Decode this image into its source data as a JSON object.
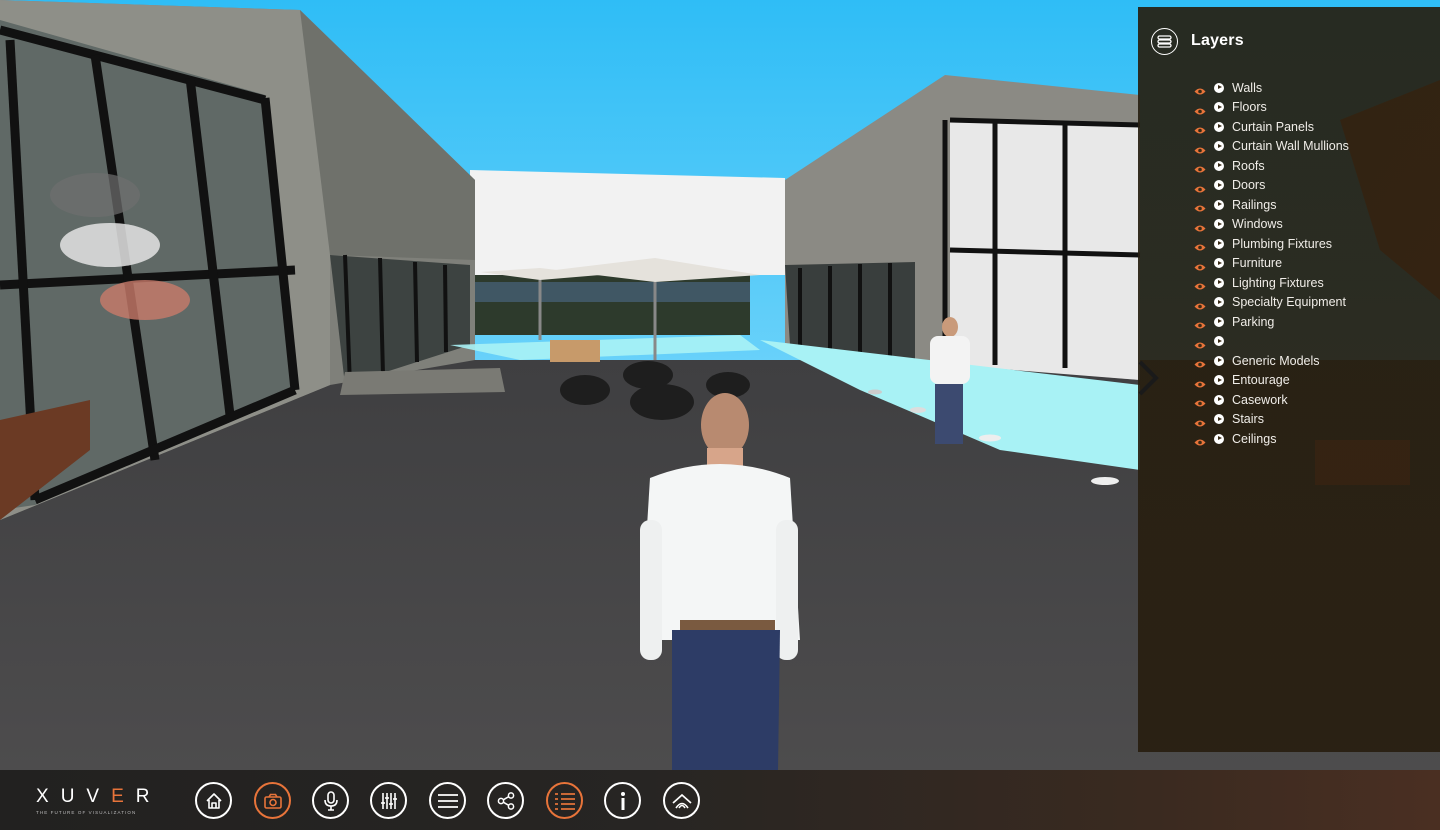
{
  "layers_panel": {
    "title": "Layers",
    "header_icon": "layers-icon",
    "items": [
      {
        "label": "Walls",
        "visible": true
      },
      {
        "label": "Floors",
        "visible": true
      },
      {
        "label": "Curtain Panels",
        "visible": true
      },
      {
        "label": "Curtain Wall Mullions",
        "visible": true
      },
      {
        "label": "Roofs",
        "visible": true
      },
      {
        "label": "Doors",
        "visible": true
      },
      {
        "label": "Railings",
        "visible": true
      },
      {
        "label": "Windows",
        "visible": true
      },
      {
        "label": "Plumbing Fixtures",
        "visible": true
      },
      {
        "label": "Furniture",
        "visible": true
      },
      {
        "label": "Lighting Fixtures",
        "visible": true
      },
      {
        "label": "Specialty Equipment",
        "visible": true
      },
      {
        "label": "Parking",
        "visible": true
      },
      {
        "label": "",
        "visible": true
      },
      {
        "label": "Generic Models",
        "visible": true
      },
      {
        "label": "Entourage",
        "visible": true
      },
      {
        "label": "Casework",
        "visible": true
      },
      {
        "label": "Stairs",
        "visible": true
      },
      {
        "label": "Ceilings",
        "visible": true
      }
    ],
    "toggle_icon": "chevron-right-icon"
  },
  "brand": {
    "letters": [
      "X",
      "U",
      "V",
      "E",
      "R"
    ],
    "accent_letter_index": 3,
    "tagline": "THE FUTURE OF VISUALIZATION"
  },
  "toolbar": {
    "buttons": [
      {
        "name": "home-button",
        "icon": "home-icon",
        "active": false
      },
      {
        "name": "screenshot-button",
        "icon": "camera-icon",
        "active": true
      },
      {
        "name": "voice-button",
        "icon": "microphone-icon",
        "active": false
      },
      {
        "name": "settings-button",
        "icon": "sliders-icon",
        "active": false
      },
      {
        "name": "menu-button",
        "icon": "hamburger-icon",
        "active": false
      },
      {
        "name": "share-button",
        "icon": "share-icon",
        "active": false
      },
      {
        "name": "layers-button",
        "icon": "list-icon",
        "active": true
      },
      {
        "name": "info-button",
        "icon": "info-icon",
        "active": false
      },
      {
        "name": "views-button",
        "icon": "house-arcs-icon",
        "active": false
      }
    ]
  },
  "colors": {
    "accent": "#e8743a",
    "sky": "#3cc3f5",
    "ground": "#4a4a4c",
    "panel_bg": "#2a2216"
  }
}
